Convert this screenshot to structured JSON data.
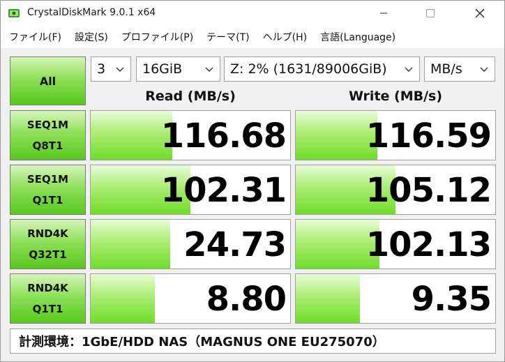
{
  "window": {
    "title": "CrystalDiskMark 9.0.1 x64"
  },
  "menu": [
    {
      "label": "ファイル(F)"
    },
    {
      "label": "設定(S)"
    },
    {
      "label": "プロファイル(P)"
    },
    {
      "label": "テーマ(T)"
    },
    {
      "label": "ヘルプ(H)"
    },
    {
      "label": "言語(Language)"
    }
  ],
  "controls": {
    "all_label": "All",
    "count": "3",
    "size": "16GiB",
    "drive": "Z: 2% (1631/89006GiB)",
    "unit": "MB/s"
  },
  "headers": {
    "read": "Read (MB/s)",
    "write": "Write (MB/s)"
  },
  "tests": [
    {
      "line1": "SEQ1M",
      "line2": "Q8T1",
      "read": "116.68",
      "write": "116.59",
      "read_fill": 0.41,
      "write_fill": 0.41
    },
    {
      "line1": "SEQ1M",
      "line2": "Q1T1",
      "read": "102.31",
      "write": "105.12",
      "read_fill": 0.5,
      "write_fill": 0.5
    },
    {
      "line1": "RND4K",
      "line2": "Q32T1",
      "read": "24.73",
      "write": "102.13",
      "read_fill": 0.4,
      "write_fill": 0.42
    },
    {
      "line1": "RND4K",
      "line2": "Q1T1",
      "read": "8.80",
      "write": "9.35",
      "read_fill": 0.32,
      "write_fill": 0.32
    }
  ],
  "comment": "計測環境：1GbE/HDD NAS（MAGNUS ONE EU275070）",
  "colors": {
    "accent_green": "#58c71e"
  }
}
